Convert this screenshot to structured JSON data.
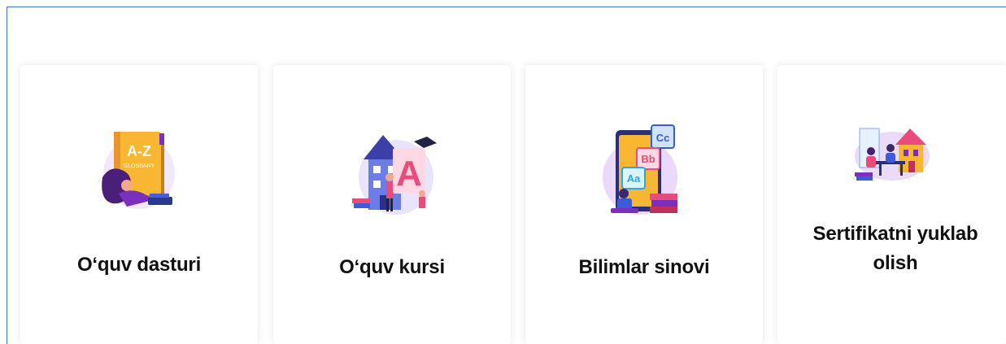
{
  "cards": [
    {
      "label": "O‘quv dasturi",
      "icon": "glossary-book-icon",
      "book_text": "A-Z",
      "book_subtext": "GLOSSARY"
    },
    {
      "label": "O‘quv kursi",
      "icon": "school-course-icon",
      "letter": "A"
    },
    {
      "label": "Bilimlar sinovi",
      "icon": "knowledge-test-icon",
      "tiles": [
        "Aa",
        "Bb",
        "Cc"
      ]
    },
    {
      "label": "Sertifikatni yuklab olish",
      "icon": "certificate-download-icon"
    }
  ],
  "colors": {
    "frame_border": "#4a72c4",
    "purple": "#7b2fbe",
    "orange": "#f39a2b",
    "pink": "#e94b7a",
    "blue": "#3d5bd9"
  }
}
